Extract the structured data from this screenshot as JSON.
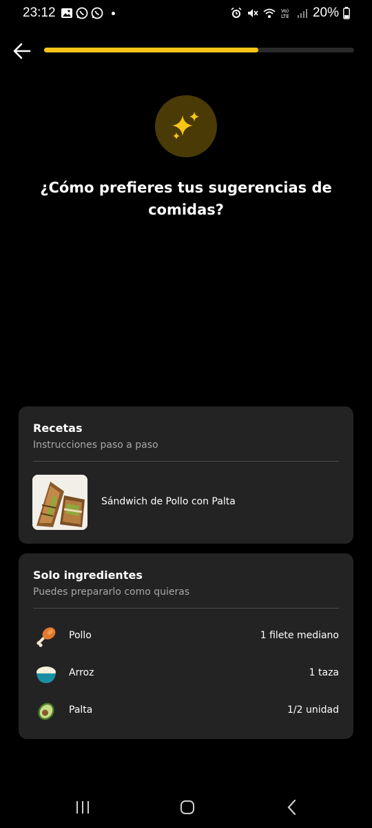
{
  "status_bar": {
    "time": "23:12",
    "battery": "20%",
    "left_icons": [
      "image-icon",
      "whatsapp-icon",
      "whatsapp-icon"
    ],
    "right_icons": [
      "alarm-icon",
      "mute-icon",
      "wifi-icon",
      "volte-icon",
      "signal-icon",
      "battery-icon"
    ]
  },
  "header": {
    "back_icon": "arrow-left-icon",
    "progress_percent": 69,
    "progress_color": "#f5c518"
  },
  "hero": {
    "icon": "sparkles-icon",
    "icon_color": "#f5c518",
    "question": "¿Cómo prefieres tus sugerencias de comidas?"
  },
  "recipes_card": {
    "title": "Recetas",
    "subtitle": "Instrucciones paso a paso",
    "recipe_name": "Sándwich de Pollo con Palta"
  },
  "ingredients_card": {
    "title": "Solo ingredientes",
    "subtitle": "Puedes prepararlo como quieras",
    "items": [
      {
        "icon": "chicken-leg-icon",
        "name": "Pollo",
        "qty": "1 filete mediano"
      },
      {
        "icon": "rice-bowl-icon",
        "name": "Arroz",
        "qty": "1 taza"
      },
      {
        "icon": "avocado-icon",
        "name": "Palta",
        "qty": "1/2 unidad"
      }
    ]
  },
  "nav": {
    "icons": [
      "recents-icon",
      "home-icon",
      "back-icon"
    ]
  }
}
